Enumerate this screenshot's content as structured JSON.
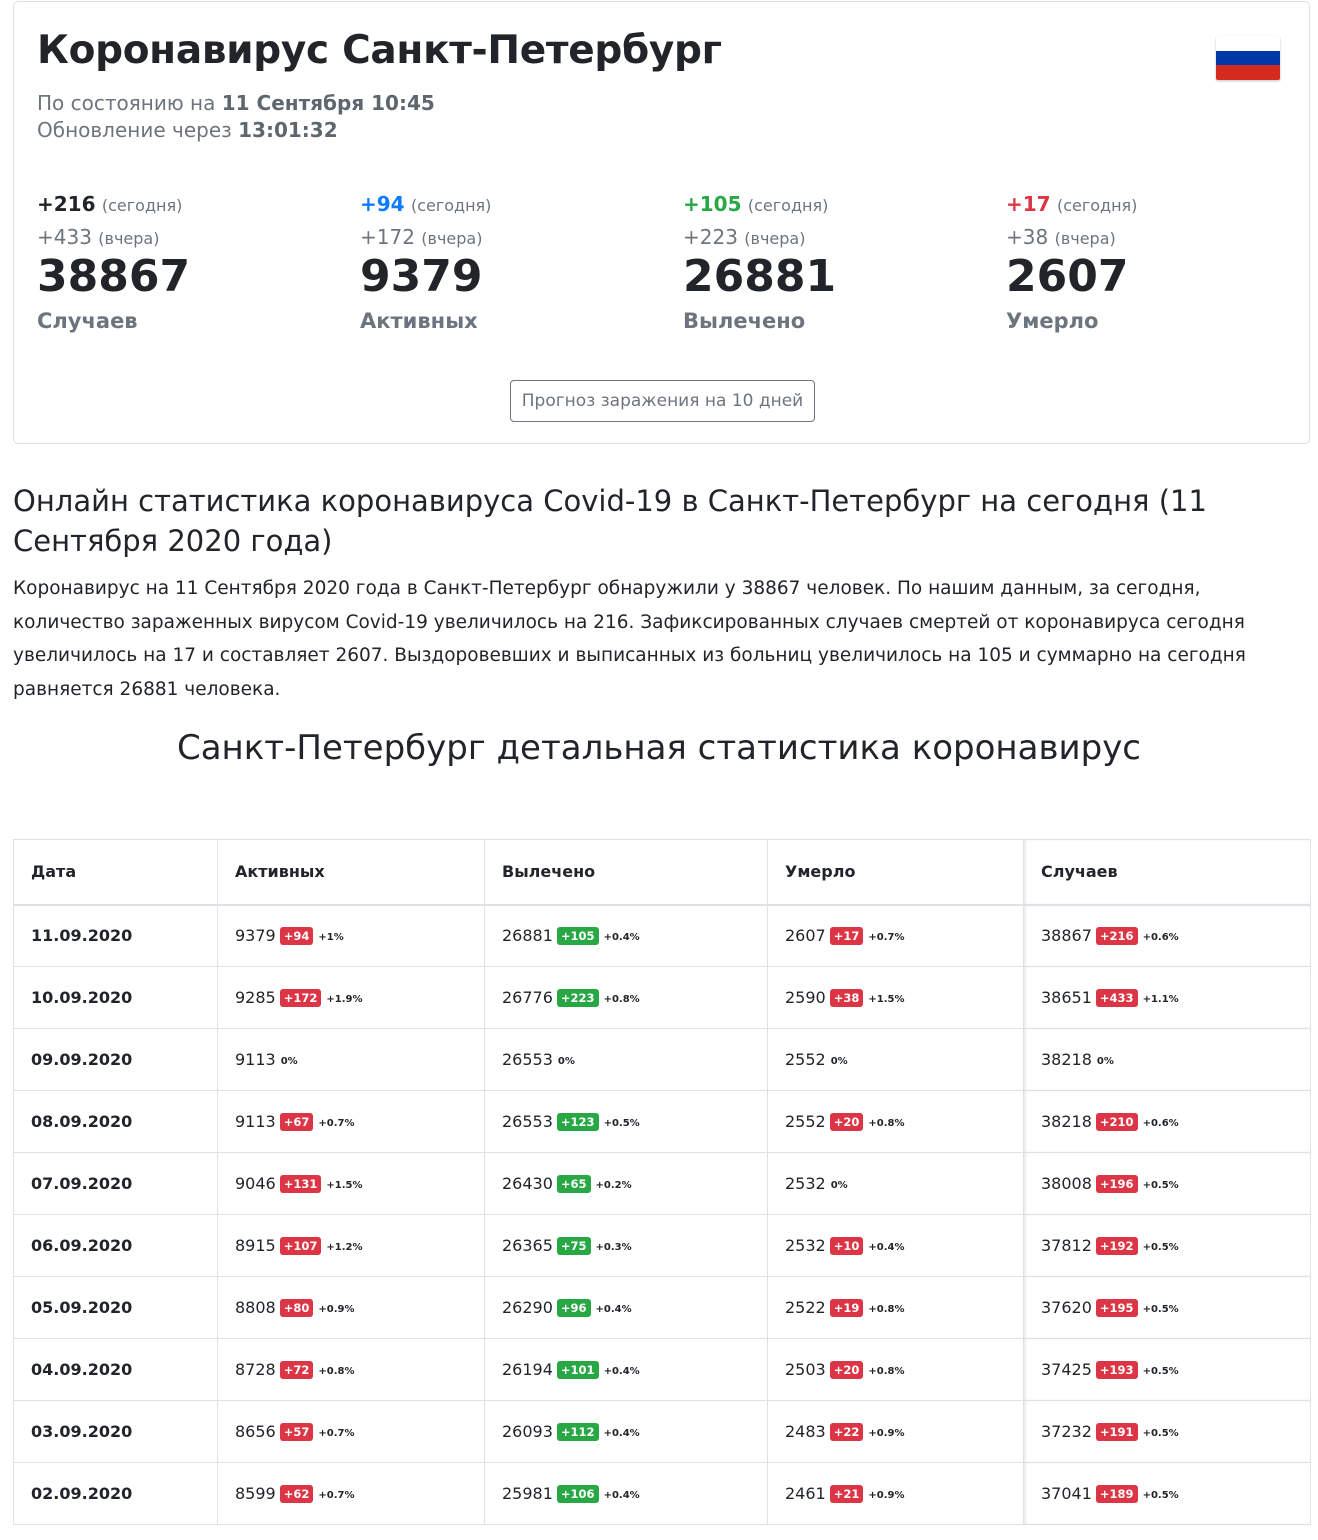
{
  "header": {
    "title": "Коронавирус Санкт-Петербург",
    "status_prefix": "По состоянию на",
    "status_value": "11 Сентября 10:45",
    "update_prefix": "Обновление через",
    "update_value": "13:01:32",
    "flag": {
      "name": "russia-flag-icon",
      "colors": [
        "#ffffff",
        "#0039a6",
        "#d52b1e"
      ]
    }
  },
  "stats": [
    {
      "today": "+216",
      "today_label": "(сегодня)",
      "yesterday": "+433",
      "yesterday_label": "(вчера)",
      "total": "38867",
      "label": "Случаев",
      "accent": "#212529"
    },
    {
      "today": "+94",
      "today_label": "(сегодня)",
      "yesterday": "+172",
      "yesterday_label": "(вчера)",
      "total": "9379",
      "label": "Активных",
      "accent": "#0d7bff"
    },
    {
      "today": "+105",
      "today_label": "(сегодня)",
      "yesterday": "+223",
      "yesterday_label": "(вчера)",
      "total": "26881",
      "label": "Вылечено",
      "accent": "#28a745"
    },
    {
      "today": "+17",
      "today_label": "(сегодня)",
      "yesterday": "+38",
      "yesterday_label": "(вчера)",
      "total": "2607",
      "label": "Умерло",
      "accent": "#dc3545"
    }
  ],
  "forecast_button": "Прогноз заражения на 10 дней",
  "article": {
    "headline": "Онлайн статистика коронавируса Covid-19 в Санкт-Петербург на сегодня (11 Сентября 2020 года)",
    "text": "Коронавирус на 11 Сентября 2020 года в Санкт-Петербург обнаружили у 38867 человек. По нашим данным, за сегодня, количество зараженных вирусом Covid-19 увеличилось на 216. Зафиксированных случаев смертей от коронавируса сегодня увеличилось на 17 и составляет 2607. Выздоровевших и выписанных из больниц увеличилось на 105 и суммарно на сегодня равняется 26881 человека."
  },
  "section_title": "Санкт-Петербург детальная статистика коронавирус",
  "table": {
    "columns": [
      "Дата",
      "Активных",
      "Вылечено",
      "Умерло",
      "Случаев"
    ],
    "rows": [
      {
        "date": "11.09.2020",
        "active": [
          "9379",
          "+94",
          "+1%"
        ],
        "recovered": [
          "26881",
          "+105",
          "+0.4%"
        ],
        "deaths": [
          "2607",
          "+17",
          "+0.7%"
        ],
        "cases": [
          "38867",
          "+216",
          "+0.6%"
        ]
      },
      {
        "date": "10.09.2020",
        "active": [
          "9285",
          "+172",
          "+1.9%"
        ],
        "recovered": [
          "26776",
          "+223",
          "+0.8%"
        ],
        "deaths": [
          "2590",
          "+38",
          "+1.5%"
        ],
        "cases": [
          "38651",
          "+433",
          "+1.1%"
        ]
      },
      {
        "date": "09.09.2020",
        "active": [
          "9113",
          "",
          "0%"
        ],
        "recovered": [
          "26553",
          "",
          "0%"
        ],
        "deaths": [
          "2552",
          "",
          "0%"
        ],
        "cases": [
          "38218",
          "",
          "0%"
        ]
      },
      {
        "date": "08.09.2020",
        "active": [
          "9113",
          "+67",
          "+0.7%"
        ],
        "recovered": [
          "26553",
          "+123",
          "+0.5%"
        ],
        "deaths": [
          "2552",
          "+20",
          "+0.8%"
        ],
        "cases": [
          "38218",
          "+210",
          "+0.6%"
        ]
      },
      {
        "date": "07.09.2020",
        "active": [
          "9046",
          "+131",
          "+1.5%"
        ],
        "recovered": [
          "26430",
          "+65",
          "+0.2%"
        ],
        "deaths": [
          "2532",
          "",
          "0%"
        ],
        "cases": [
          "38008",
          "+196",
          "+0.5%"
        ]
      },
      {
        "date": "06.09.2020",
        "active": [
          "8915",
          "+107",
          "+1.2%"
        ],
        "recovered": [
          "26365",
          "+75",
          "+0.3%"
        ],
        "deaths": [
          "2532",
          "+10",
          "+0.4%"
        ],
        "cases": [
          "37812",
          "+192",
          "+0.5%"
        ]
      },
      {
        "date": "05.09.2020",
        "active": [
          "8808",
          "+80",
          "+0.9%"
        ],
        "recovered": [
          "26290",
          "+96",
          "+0.4%"
        ],
        "deaths": [
          "2522",
          "+19",
          "+0.8%"
        ],
        "cases": [
          "37620",
          "+195",
          "+0.5%"
        ]
      },
      {
        "date": "04.09.2020",
        "active": [
          "8728",
          "+72",
          "+0.8%"
        ],
        "recovered": [
          "26194",
          "+101",
          "+0.4%"
        ],
        "deaths": [
          "2503",
          "+20",
          "+0.8%"
        ],
        "cases": [
          "37425",
          "+193",
          "+0.5%"
        ]
      },
      {
        "date": "03.09.2020",
        "active": [
          "8656",
          "+57",
          "+0.7%"
        ],
        "recovered": [
          "26093",
          "+112",
          "+0.4%"
        ],
        "deaths": [
          "2483",
          "+22",
          "+0.9%"
        ],
        "cases": [
          "37232",
          "+191",
          "+0.5%"
        ]
      },
      {
        "date": "02.09.2020",
        "active": [
          "8599",
          "+62",
          "+0.7%"
        ],
        "recovered": [
          "25981",
          "+106",
          "+0.4%"
        ],
        "deaths": [
          "2461",
          "+21",
          "+0.9%"
        ],
        "cases": [
          "37041",
          "+189",
          "+0.5%"
        ]
      }
    ],
    "badge_colors": {
      "increase": "#dc3545",
      "recovered": "#28a745"
    }
  }
}
